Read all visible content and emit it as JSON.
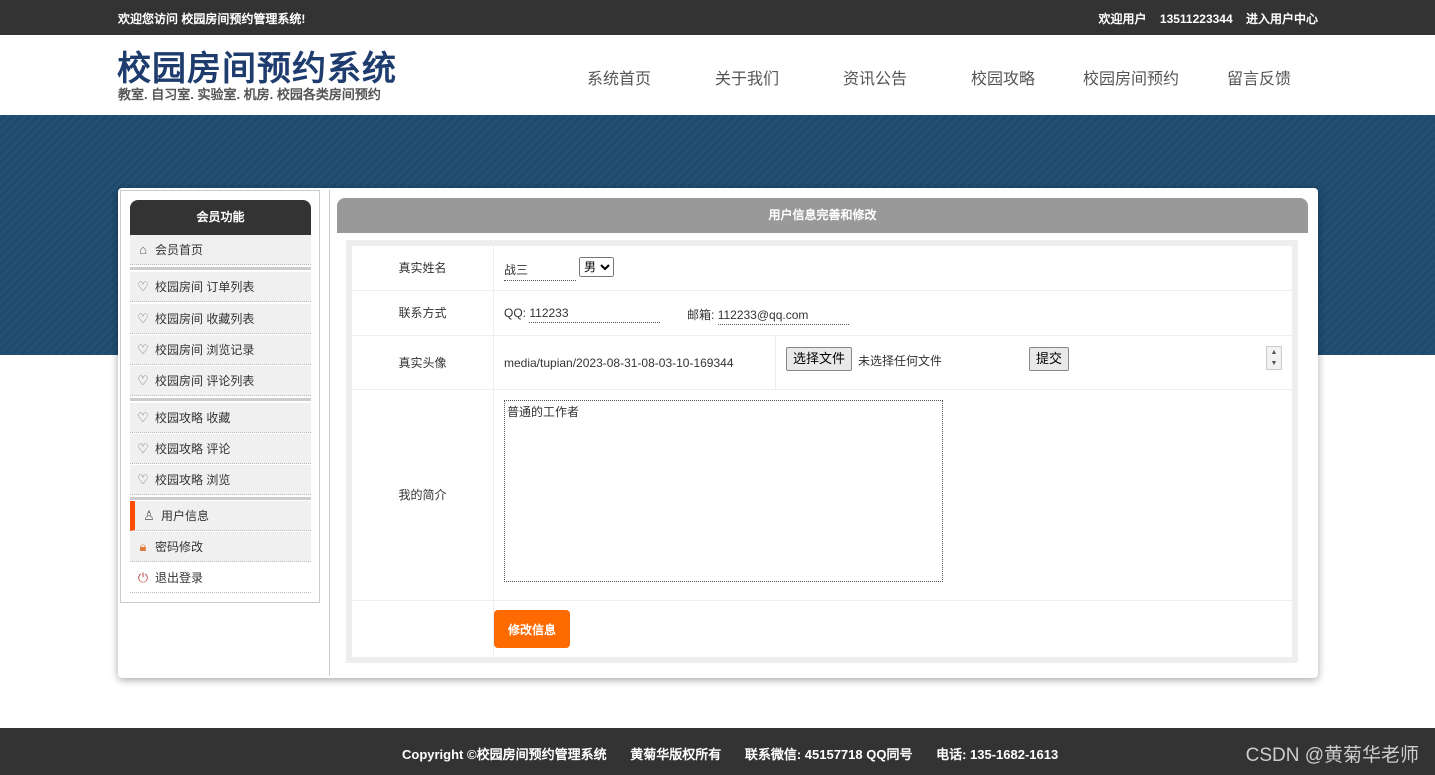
{
  "topbar": {
    "welcome": "欢迎您访问 校园房间预约管理系统!",
    "user_label": "欢迎用户",
    "user_phone": "13511223344",
    "user_center": "进入用户中心"
  },
  "header": {
    "title": "校园房间预约系统",
    "subtitle": "教室. 自习室. 实验室. 机房. 校园各类房间预约",
    "nav": [
      "系统首页",
      "关于我们",
      "资讯公告",
      "校园攻略",
      "校园房间预约",
      "留言反馈"
    ]
  },
  "sidebar": {
    "title": "会员功能",
    "items": [
      {
        "label": "会员首页",
        "icon": "home-icon"
      },
      {
        "label": "校园房间 订单列表",
        "icon": "shield-icon"
      },
      {
        "label": "校园房间 收藏列表",
        "icon": "shield-icon"
      },
      {
        "label": "校园房间 浏览记录",
        "icon": "shield-icon"
      },
      {
        "label": "校园房间 评论列表",
        "icon": "shield-icon"
      },
      {
        "label": "校园攻略 收藏",
        "icon": "shield-icon"
      },
      {
        "label": "校园攻略 评论",
        "icon": "shield-icon"
      },
      {
        "label": "校园攻略 浏览",
        "icon": "shield-icon"
      },
      {
        "label": "用户信息",
        "icon": "user-icon"
      },
      {
        "label": "密码修改",
        "icon": "lock-icon"
      },
      {
        "label": "退出登录",
        "icon": "power-icon"
      }
    ],
    "active_color": "#ff4c00"
  },
  "panel": {
    "title": "用户信息完善和修改",
    "fields": {
      "name_label": "真实姓名",
      "name_value": "战三",
      "sex_value": "男",
      "contact_label": "联系方式",
      "qq_label": "QQ:",
      "qq_value": "112233",
      "email_label": "邮箱:",
      "email_value": "112233@qq.com",
      "avatar_label": "真实头像",
      "avatar_path": "media/tupian/2023-08-31-08-03-10-169344",
      "choose_file": "选择文件",
      "no_file": "未选择任何文件",
      "upload_button": "提交",
      "intro_label": "我的简介",
      "intro_value": "普通的工作者"
    },
    "submit_label": "修改信息",
    "submit_color": "#ff6a00"
  },
  "footer": {
    "copyright": "Copyright ©校园房间预约管理系统",
    "owner": "黄菊华版权所有",
    "wechat": "联系微信: 45157718 QQ同号",
    "phone": "电话: 135-1682-1613",
    "watermark": "CSDN @黄菊华老师"
  }
}
